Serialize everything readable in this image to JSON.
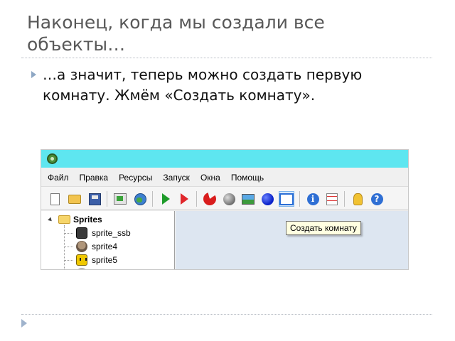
{
  "slide": {
    "title": "Наконец, когда мы создали все объекты…",
    "bullet": "…а значит, теперь можно создать первую комнату. Жмём «Создать комнату»."
  },
  "app": {
    "menu": [
      "Файл",
      "Правка",
      "Ресурсы",
      "Запуск",
      "Окна",
      "Помощь"
    ],
    "toolbar_icons": [
      "new-file-icon",
      "open-folder-icon",
      "save-icon",
      "create-executable-icon",
      "publish-globe-icon",
      "run-icon",
      "run-debug-icon",
      "create-sprite-icon",
      "create-sound-icon",
      "create-background-icon",
      "create-object-icon",
      "create-room-icon",
      "game-information-icon",
      "global-settings-icon",
      "extensions-icon",
      "help-icon"
    ],
    "tree": {
      "root": "Sprites",
      "items": [
        "sprite_ssb",
        "sprite4",
        "sprite5"
      ]
    },
    "tooltip": "Создать комнату",
    "colors": {
      "titlebar": "#5ee6f0",
      "workspace": "#dde6f1",
      "tooltip_bg": "#ffffe1"
    }
  }
}
